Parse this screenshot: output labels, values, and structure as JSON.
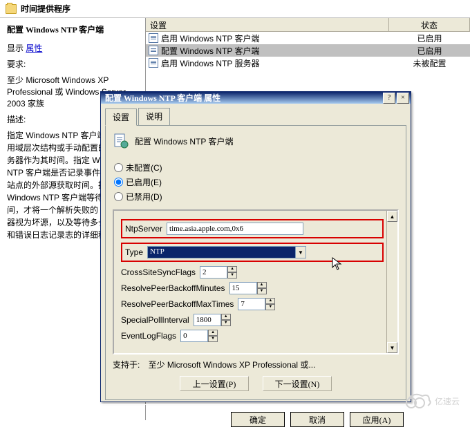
{
  "explorer": {
    "title": "时间提供程序"
  },
  "left": {
    "heading": "配置 Windows NTP 客户端",
    "showLabel": "显示",
    "showLink": "属性",
    "reqLabel": "要求:",
    "reqText": "至少 Microsoft Windows XP Professional 或 Windows Server 2003 家族",
    "descLabel": "描述:",
    "descText": "指定 Windows NTP 客户端是否使用域层次结构或手动配置的 NTP 服务器作为其时间。指定 Windows NTP 客户端是否记录事件，以从其站点的外部源获取时间。指定 Windows NTP 客户端等待多长时间，才将一个解析失败的 NTP 服务器视为坏源，以及等待多长时间，和错误日志记录志的详细程度。"
  },
  "grid": {
    "headers": {
      "setting": "设置",
      "status": "状态"
    },
    "rows": [
      {
        "label": "启用 Windows NTP 客户端",
        "status": "已启用"
      },
      {
        "label": "配置 Windows NTP 客户端",
        "status": "已启用"
      },
      {
        "label": "启用 Windows NTP 服务器",
        "status": "未被配置"
      }
    ]
  },
  "dialog": {
    "title": "配置 Windows NTP 客户端 属性",
    "helpBtn": "?",
    "closeBtn": "×",
    "tabs": {
      "setting": "设置",
      "explain": "说明"
    },
    "headerText": "配置 Windows NTP 客户端",
    "radios": {
      "notConfigured": "未配置(C)",
      "enabled": "已启用(E)",
      "disabled": "已禁用(D)"
    },
    "fields": {
      "ntpServerLabel": "NtpServer",
      "ntpServerValue": "time.asia.apple.com,0x6",
      "typeLabel": "Type",
      "typeValue": "NTP",
      "crossSiteLabel": "CrossSiteSyncFlags",
      "crossSiteValue": "2",
      "resolveMinLabel": "ResolvePeerBackoffMinutes",
      "resolveMinValue": "15",
      "resolveMaxLabel": "ResolvePeerBackoffMaxTimes",
      "resolveMaxValue": "7",
      "pollLabel": "SpecialPollInterval",
      "pollValue": "1800",
      "eventLogLabel": "EventLogFlags",
      "eventLogValue": "0"
    },
    "supportedLabel": "支持于:",
    "supportedValue": "至少 Microsoft Windows XP Professional 或...",
    "buttons": {
      "prev": "上一设置(P)",
      "next": "下一设置(N)",
      "ok": "确定",
      "cancel": "取消",
      "apply": "应用(A)"
    }
  },
  "watermark": "亿速云"
}
